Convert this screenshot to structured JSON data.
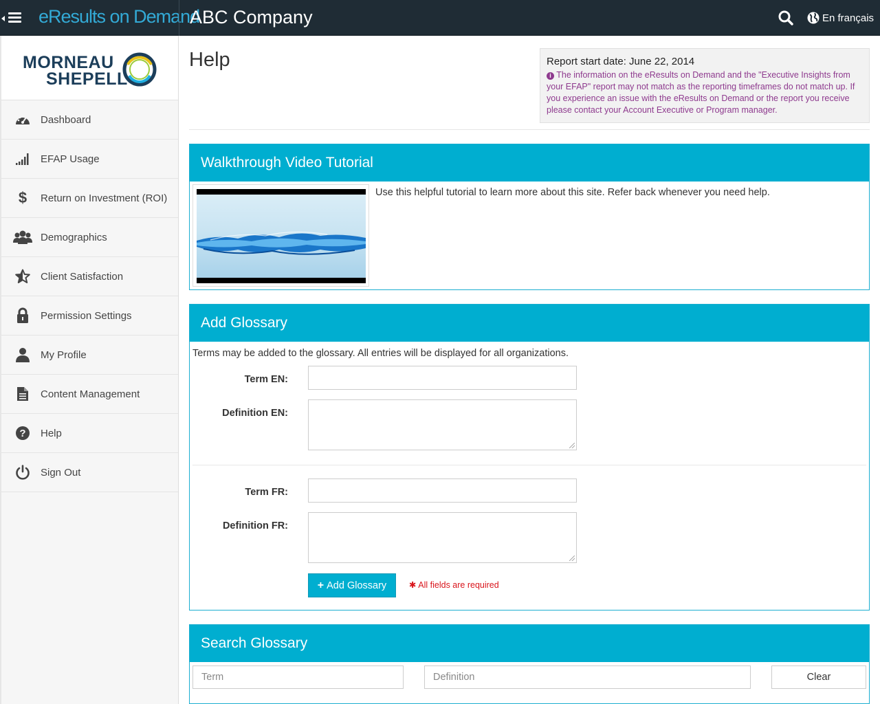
{
  "header": {
    "brand": "eResults on Demand",
    "company": "ABC Company",
    "language_link": "En français"
  },
  "sidebar": {
    "logo_line1": "MORNEAU",
    "logo_line2": "SHEPELL",
    "items": [
      {
        "label": "Dashboard",
        "icon": "dashboard-icon"
      },
      {
        "label": "EFAP Usage",
        "icon": "signal-bars-icon"
      },
      {
        "label": "Return on Investment (ROI)",
        "icon": "dollar-icon"
      },
      {
        "label": "Demographics",
        "icon": "group-icon"
      },
      {
        "label": "Client Satisfaction",
        "icon": "star-icon"
      },
      {
        "label": "Permission Settings",
        "icon": "lock-icon"
      },
      {
        "label": "My Profile",
        "icon": "user-icon"
      },
      {
        "label": "Content Management",
        "icon": "document-icon"
      },
      {
        "label": "Help",
        "icon": "question-icon"
      },
      {
        "label": "Sign Out",
        "icon": "power-icon"
      }
    ]
  },
  "page": {
    "title": "Help",
    "report_date": "Report start date: June 22, 2014",
    "report_note": "The information on the eResults on Demand and the \"Executive Insights from your EFAP\" report may not match as the reporting timeframes do not match up. If you experience an issue with the eResults on Demand or the report you receive please contact your Account Executive or Program manager."
  },
  "video_panel": {
    "title": "Walkthrough Video Tutorial",
    "description": "Use this helpful tutorial to learn more about this site. Refer back whenever you need help."
  },
  "glossary_panel": {
    "title": "Add Glossary",
    "intro": "Terms may be added to the glossary. All entries will be displayed for all organizations.",
    "term_en_label": "Term EN:",
    "def_en_label": "Definition EN:",
    "term_fr_label": "Term FR:",
    "def_fr_label": "Definition FR:",
    "term_en_value": "",
    "def_en_value": "",
    "term_fr_value": "",
    "def_fr_value": "",
    "add_button": "Add Glossary",
    "required_note": "All fields are required"
  },
  "search_panel": {
    "title": "Search Glossary",
    "term_placeholder": "Term",
    "definition_placeholder": "Definition",
    "clear_button": "Clear"
  },
  "colors": {
    "topbar": "#1f2c35",
    "brand": "#33aad6",
    "accent": "#00aed0",
    "note": "#8e3a8e",
    "required": "#d9141b"
  }
}
